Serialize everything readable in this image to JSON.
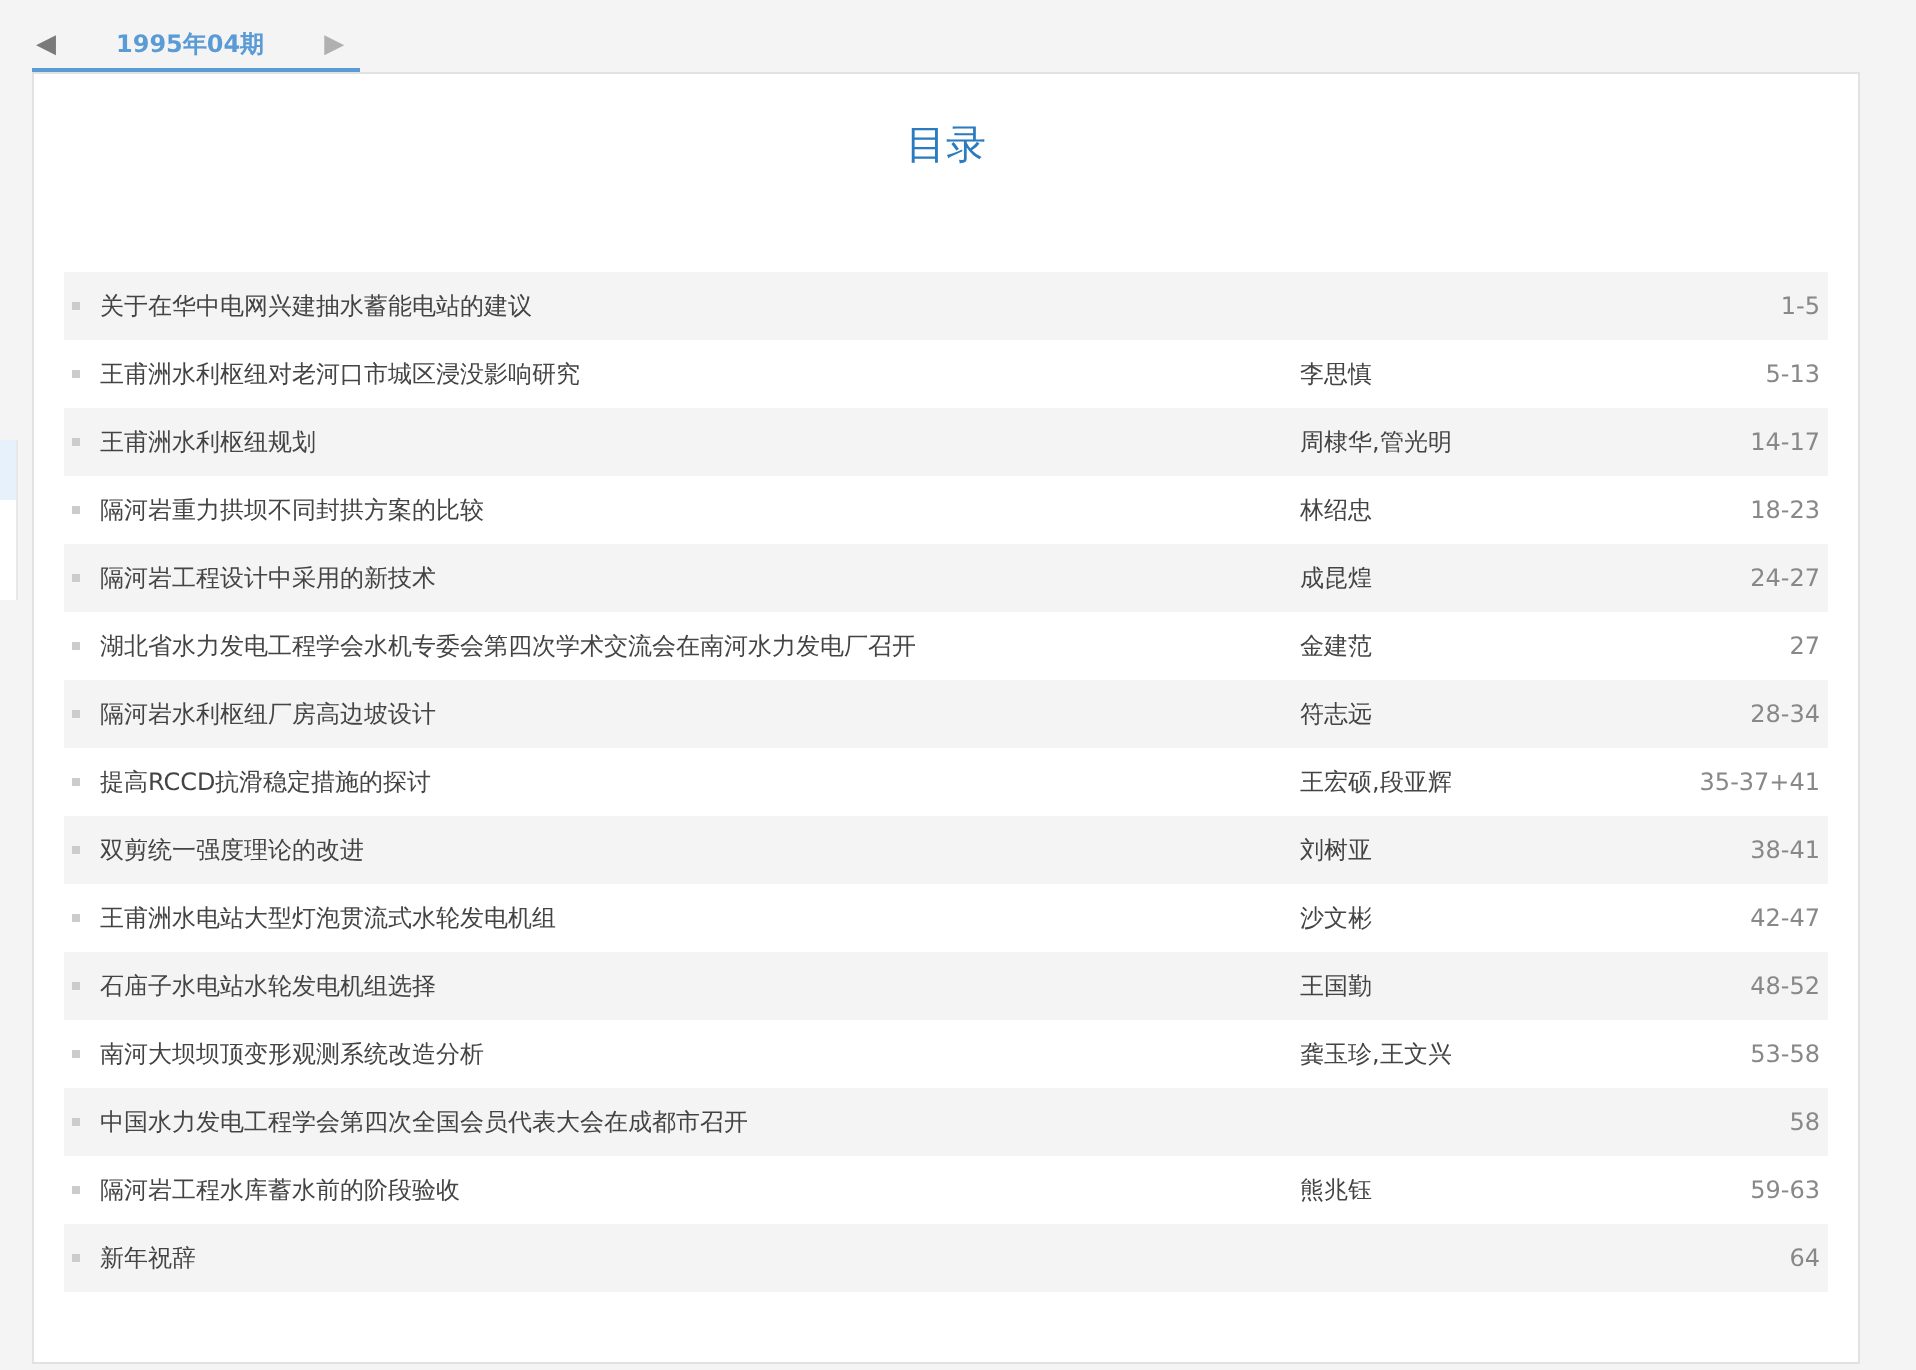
{
  "issue_nav": {
    "prev": {
      "glyph": "◀",
      "disabled": false
    },
    "next": {
      "glyph": "▶",
      "disabled": true
    },
    "tabs": [
      {
        "label": "1995年04期",
        "selected": true
      }
    ]
  },
  "toc": {
    "title": "目录",
    "rows": [
      {
        "title": "关于在华中电网兴建抽水蓄能电站的建议",
        "pages": "1-5"
      },
      {
        "title": "王甫洲水利枢纽对老河口市城区浸没影响研究",
        "author": "李思慎",
        "pages": "5-13"
      },
      {
        "title": "王甫洲水利枢纽规划",
        "author": "周棣华,管光明",
        "pages": "14-17"
      },
      {
        "title": "隔河岩重力拱坝不同封拱方案的比较",
        "author": "林绍忠",
        "pages": "18-23"
      },
      {
        "title": "隔河岩工程设计中采用的新技术",
        "author": "成昆煌",
        "pages": "24-27"
      },
      {
        "title": "湖北省水力发电工程学会水机专委会第四次学术交流会在南河水力发电厂召开",
        "author": "金建范",
        "pages": "27"
      },
      {
        "title": "隔河岩水利枢纽厂房高边坡设计",
        "author": "符志远",
        "pages": "28-34"
      },
      {
        "title": "提高RCCD抗滑稳定措施的探讨",
        "author": "王宏硕,段亚辉",
        "pages": "35-37+41"
      },
      {
        "title": "双剪统一强度理论的改进",
        "author": "刘树亚",
        "pages": "38-41"
      },
      {
        "title": "王甫洲水电站大型灯泡贯流式水轮发电机组",
        "author": "沙文彬",
        "pages": "42-47"
      },
      {
        "title": "石庙子水电站水轮发电机组选择",
        "author": "王国勤",
        "pages": "48-52"
      },
      {
        "title": "南河大坝坝顶变形观测系统改造分析",
        "author": "龚玉珍,王文兴",
        "pages": "53-58"
      },
      {
        "title": "中国水力发电工程学会第四次全国会员代表大会在成都市召开",
        "pages": "58"
      },
      {
        "title": "隔河岩工程水库蓄水前的阶段验收",
        "author": "熊兆钰",
        "pages": "59-63"
      },
      {
        "title": "新年祝辞",
        "pages": "64"
      }
    ]
  }
}
